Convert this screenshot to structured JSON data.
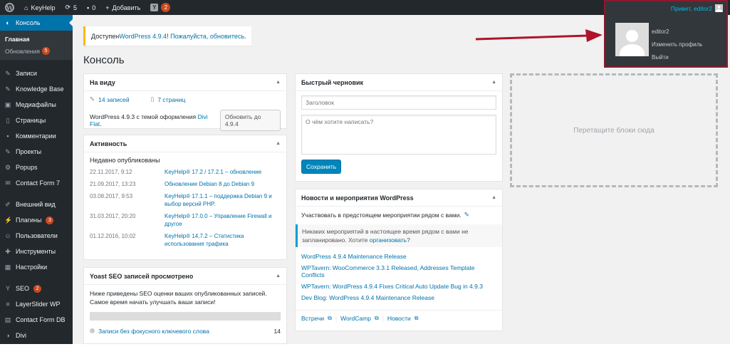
{
  "admin_bar": {
    "site_name": "KeyHelp",
    "updates_count": "5",
    "comments_count": "0",
    "add_new": "Добавить",
    "yoast_badge": "2",
    "howdy": "Привет, editor2"
  },
  "account_menu": {
    "username": "editor2",
    "edit_profile": "Изменить профиль",
    "logout": "Выйти"
  },
  "sidebar": {
    "dashboard": "Консоль",
    "home": "Главная",
    "updates": "Обновления",
    "updates_badge": "5",
    "posts": "Записи",
    "knowledge_base": "Knowledge Base",
    "media": "Медиафайлы",
    "pages": "Страницы",
    "comments": "Комментарии",
    "projects": "Проекты",
    "popups": "Popups",
    "contact_form_7": "Contact Form 7",
    "appearance": "Внешний вид",
    "plugins": "Плагины",
    "plugins_badge": "3",
    "users": "Пользователи",
    "tools": "Инструменты",
    "settings": "Настройки",
    "seo": "SEO",
    "seo_badge": "2",
    "layerslider": "LayerSlider WP",
    "contact_form_db": "Contact Form DB",
    "divi": "Divi"
  },
  "notice": {
    "prefix": "Доступен ",
    "link1": "WordPress 4.9.4",
    "sep": "! ",
    "link2": "Пожалуйста, обновитесь",
    "suffix": "."
  },
  "page_title": "Консоль",
  "glance": {
    "title": "На виду",
    "posts": "14 записей",
    "pages": "7 страниц",
    "version_text": "WordPress 4.9.3 с темой оформления ",
    "theme": "Divi Flat",
    "version_suffix": ".",
    "update_button": "Обновить до 4.9.4"
  },
  "activity": {
    "title": "Активность",
    "recent_label": "Недавно опубликованы",
    "items": [
      {
        "date": "22.11.2017, 9:12",
        "title": "KeyHelp® 17.2 / 17.2.1 – обновление"
      },
      {
        "date": "21.09.2017, 13:23",
        "title": "Обновление Debian 8 до Debian 9"
      },
      {
        "date": "03.08.2017, 9:53",
        "title": "KeyHelp® 17.1.1 – поддержка Debian 9 и выбор версий PHP."
      },
      {
        "date": "31.03.2017, 20:20",
        "title": "KeyHelp® 17.0.0 – Управление Firewall и другое"
      },
      {
        "date": "01.12.2016, 10:02",
        "title": "KeyHelp® 14.7.2 – Статистика использования трафика"
      }
    ]
  },
  "yoast": {
    "title": "Yoast SEO записей просмотрено",
    "text": "Ниже приведены SEO оценки ваших опубликованных записей. Самое время начать улучшать ваши записи!",
    "row_label": "Записи без фокусного ключевого слова",
    "row_count": "14"
  },
  "quick_draft": {
    "title": "Быстрый черновик",
    "title_placeholder": "Заголовок",
    "content_placeholder": "О чём хотите написать?",
    "save_button": "Сохранить"
  },
  "events": {
    "title": "Новости и мероприятия WordPress",
    "lead": "Участвовать в предстоящем мероприятии рядом с вами.",
    "notice_text": "Никаких мероприятий в настоящее время рядом с вами не запланировано. Хотите ",
    "notice_link": "организовать",
    "notice_end": "?",
    "news": [
      "WordPress 4.9.4 Maintenance Release",
      "WPTavern: WooCommerce 3.3.1 Released, Addresses Template Conflicts",
      "WPTavern: WordPress 4.9.4 Fixes Critical Auto Update Bug in 4.9.3",
      "Dev Blog: WordPress 4.9.4 Maintenance Release"
    ],
    "footer_meetups": "Встречи",
    "footer_wordcamp": "WordCamp",
    "footer_news": "Новости"
  },
  "dropzone": {
    "text": "Перетащите блоки сюда"
  },
  "colors": {
    "admin_bar": "#23282d",
    "accent": "#0073aa",
    "badge": "#ca4a1f",
    "highlight_border": "#8b1a2b",
    "arrow": "#b0132c"
  }
}
